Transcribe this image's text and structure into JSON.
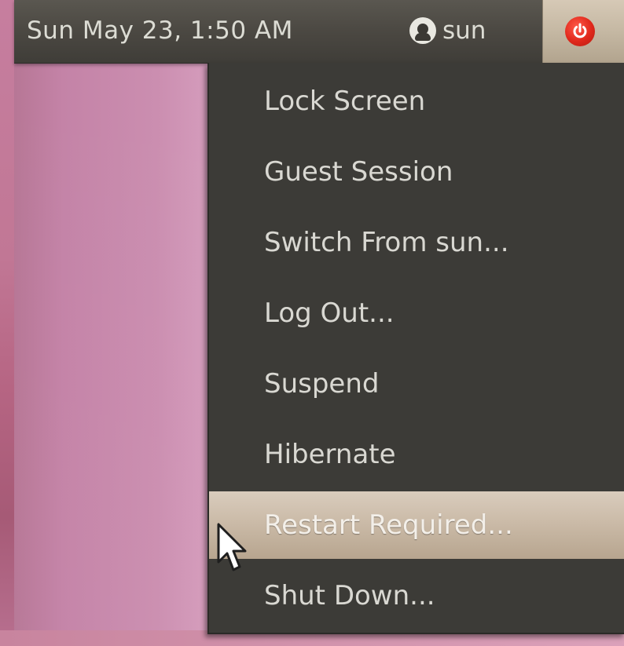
{
  "panel": {
    "clock": "Sun May 23,  1:50 AM",
    "user_name": "sun",
    "user_icon": "user-icon",
    "power_icon": "power-icon"
  },
  "menu": {
    "items": [
      {
        "label": "Lock Screen"
      },
      {
        "label": "Guest Session"
      },
      {
        "label": "Switch From sun..."
      },
      {
        "label": "Log Out..."
      },
      {
        "label": "Suspend"
      },
      {
        "label": "Hibernate"
      },
      {
        "label": "Restart Required...",
        "highlighted": true
      },
      {
        "label": "Shut Down..."
      }
    ]
  },
  "colors": {
    "panel_bg": "#4b4842",
    "menu_bg": "#3c3b37",
    "highlight_bg": "#cbbba8",
    "power_red": "#e0281b",
    "desktop_pink": "#d08aa9",
    "text": "#dcdcd4"
  }
}
